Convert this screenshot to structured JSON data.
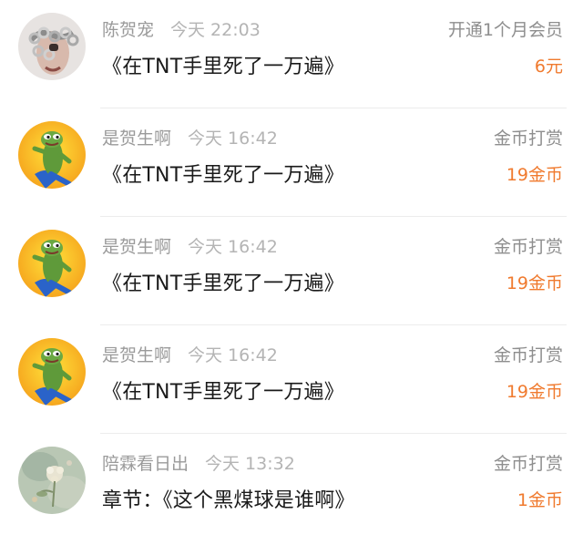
{
  "colors": {
    "amount": "#f07a2e",
    "meta": "#9a9a9a",
    "title": "#1a1a1a"
  },
  "items": [
    {
      "user": "陈贺宠",
      "time": "今天 22:03",
      "title": "《在TNT手里死了一万遍》",
      "action": "开通1个月会员",
      "amount": "6元",
      "avatar": "chain-person-avatar"
    },
    {
      "user": "是贺生啊",
      "time": "今天 16:42",
      "title": "《在TNT手里死了一万遍》",
      "action": "金币打赏",
      "amount": "19金币",
      "avatar": "frog-avatar"
    },
    {
      "user": "是贺生啊",
      "time": "今天 16:42",
      "title": "《在TNT手里死了一万遍》",
      "action": "金币打赏",
      "amount": "19金币",
      "avatar": "frog-avatar"
    },
    {
      "user": "是贺生啊",
      "time": "今天 16:42",
      "title": "《在TNT手里死了一万遍》",
      "action": "金币打赏",
      "amount": "19金币",
      "avatar": "frog-avatar"
    },
    {
      "user": "陪霖看日出",
      "time": "今天 13:32",
      "title": "章节：《这个黑煤球是谁啊》",
      "action": "金币打赏",
      "amount": "1金币",
      "avatar": "flower-painting-avatar"
    }
  ]
}
